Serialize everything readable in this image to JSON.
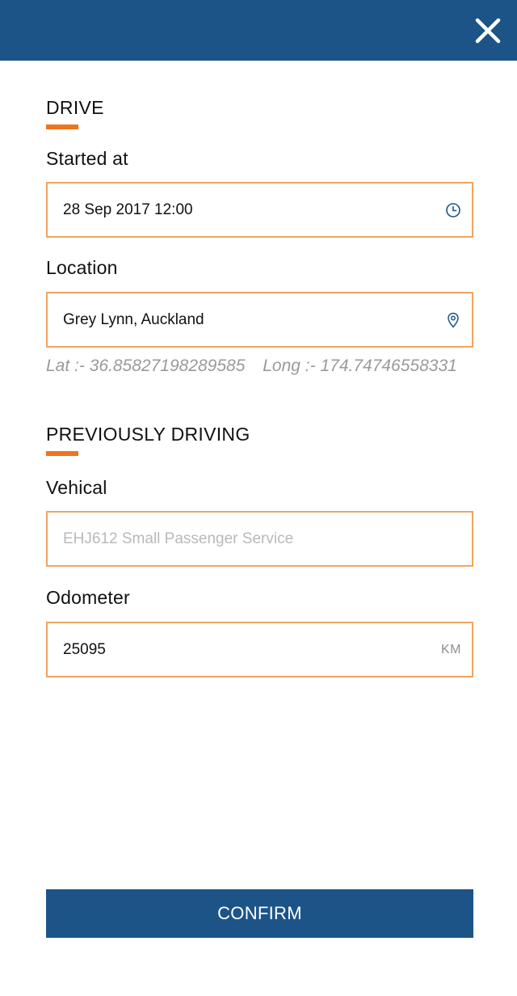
{
  "header": {
    "close_icon": "close-icon"
  },
  "drive": {
    "title": "DRIVE",
    "started_at_label": "Started at",
    "started_at_value": "28 Sep 2017  12:00",
    "started_at_icon": "clock-icon",
    "location_label": "Location",
    "location_value": "Grey Lynn, Auckland",
    "location_icon": "map-pin-icon",
    "lat_text": "Lat :- 36.85827198289585",
    "long_text": "Long :- 174.74746558331"
  },
  "previously_driving": {
    "title": "PREVIOUSLY DRIVING",
    "vehicle_label": "Vehical",
    "vehicle_placeholder": "EHJ612 Small Passenger Service",
    "odometer_label": "Odometer",
    "odometer_value": "25095",
    "odometer_unit": "KM"
  },
  "actions": {
    "confirm_label": "CONFIRM"
  },
  "colors": {
    "primary": "#1c5488",
    "accent": "#f07320",
    "field_border": "#f0a560"
  }
}
